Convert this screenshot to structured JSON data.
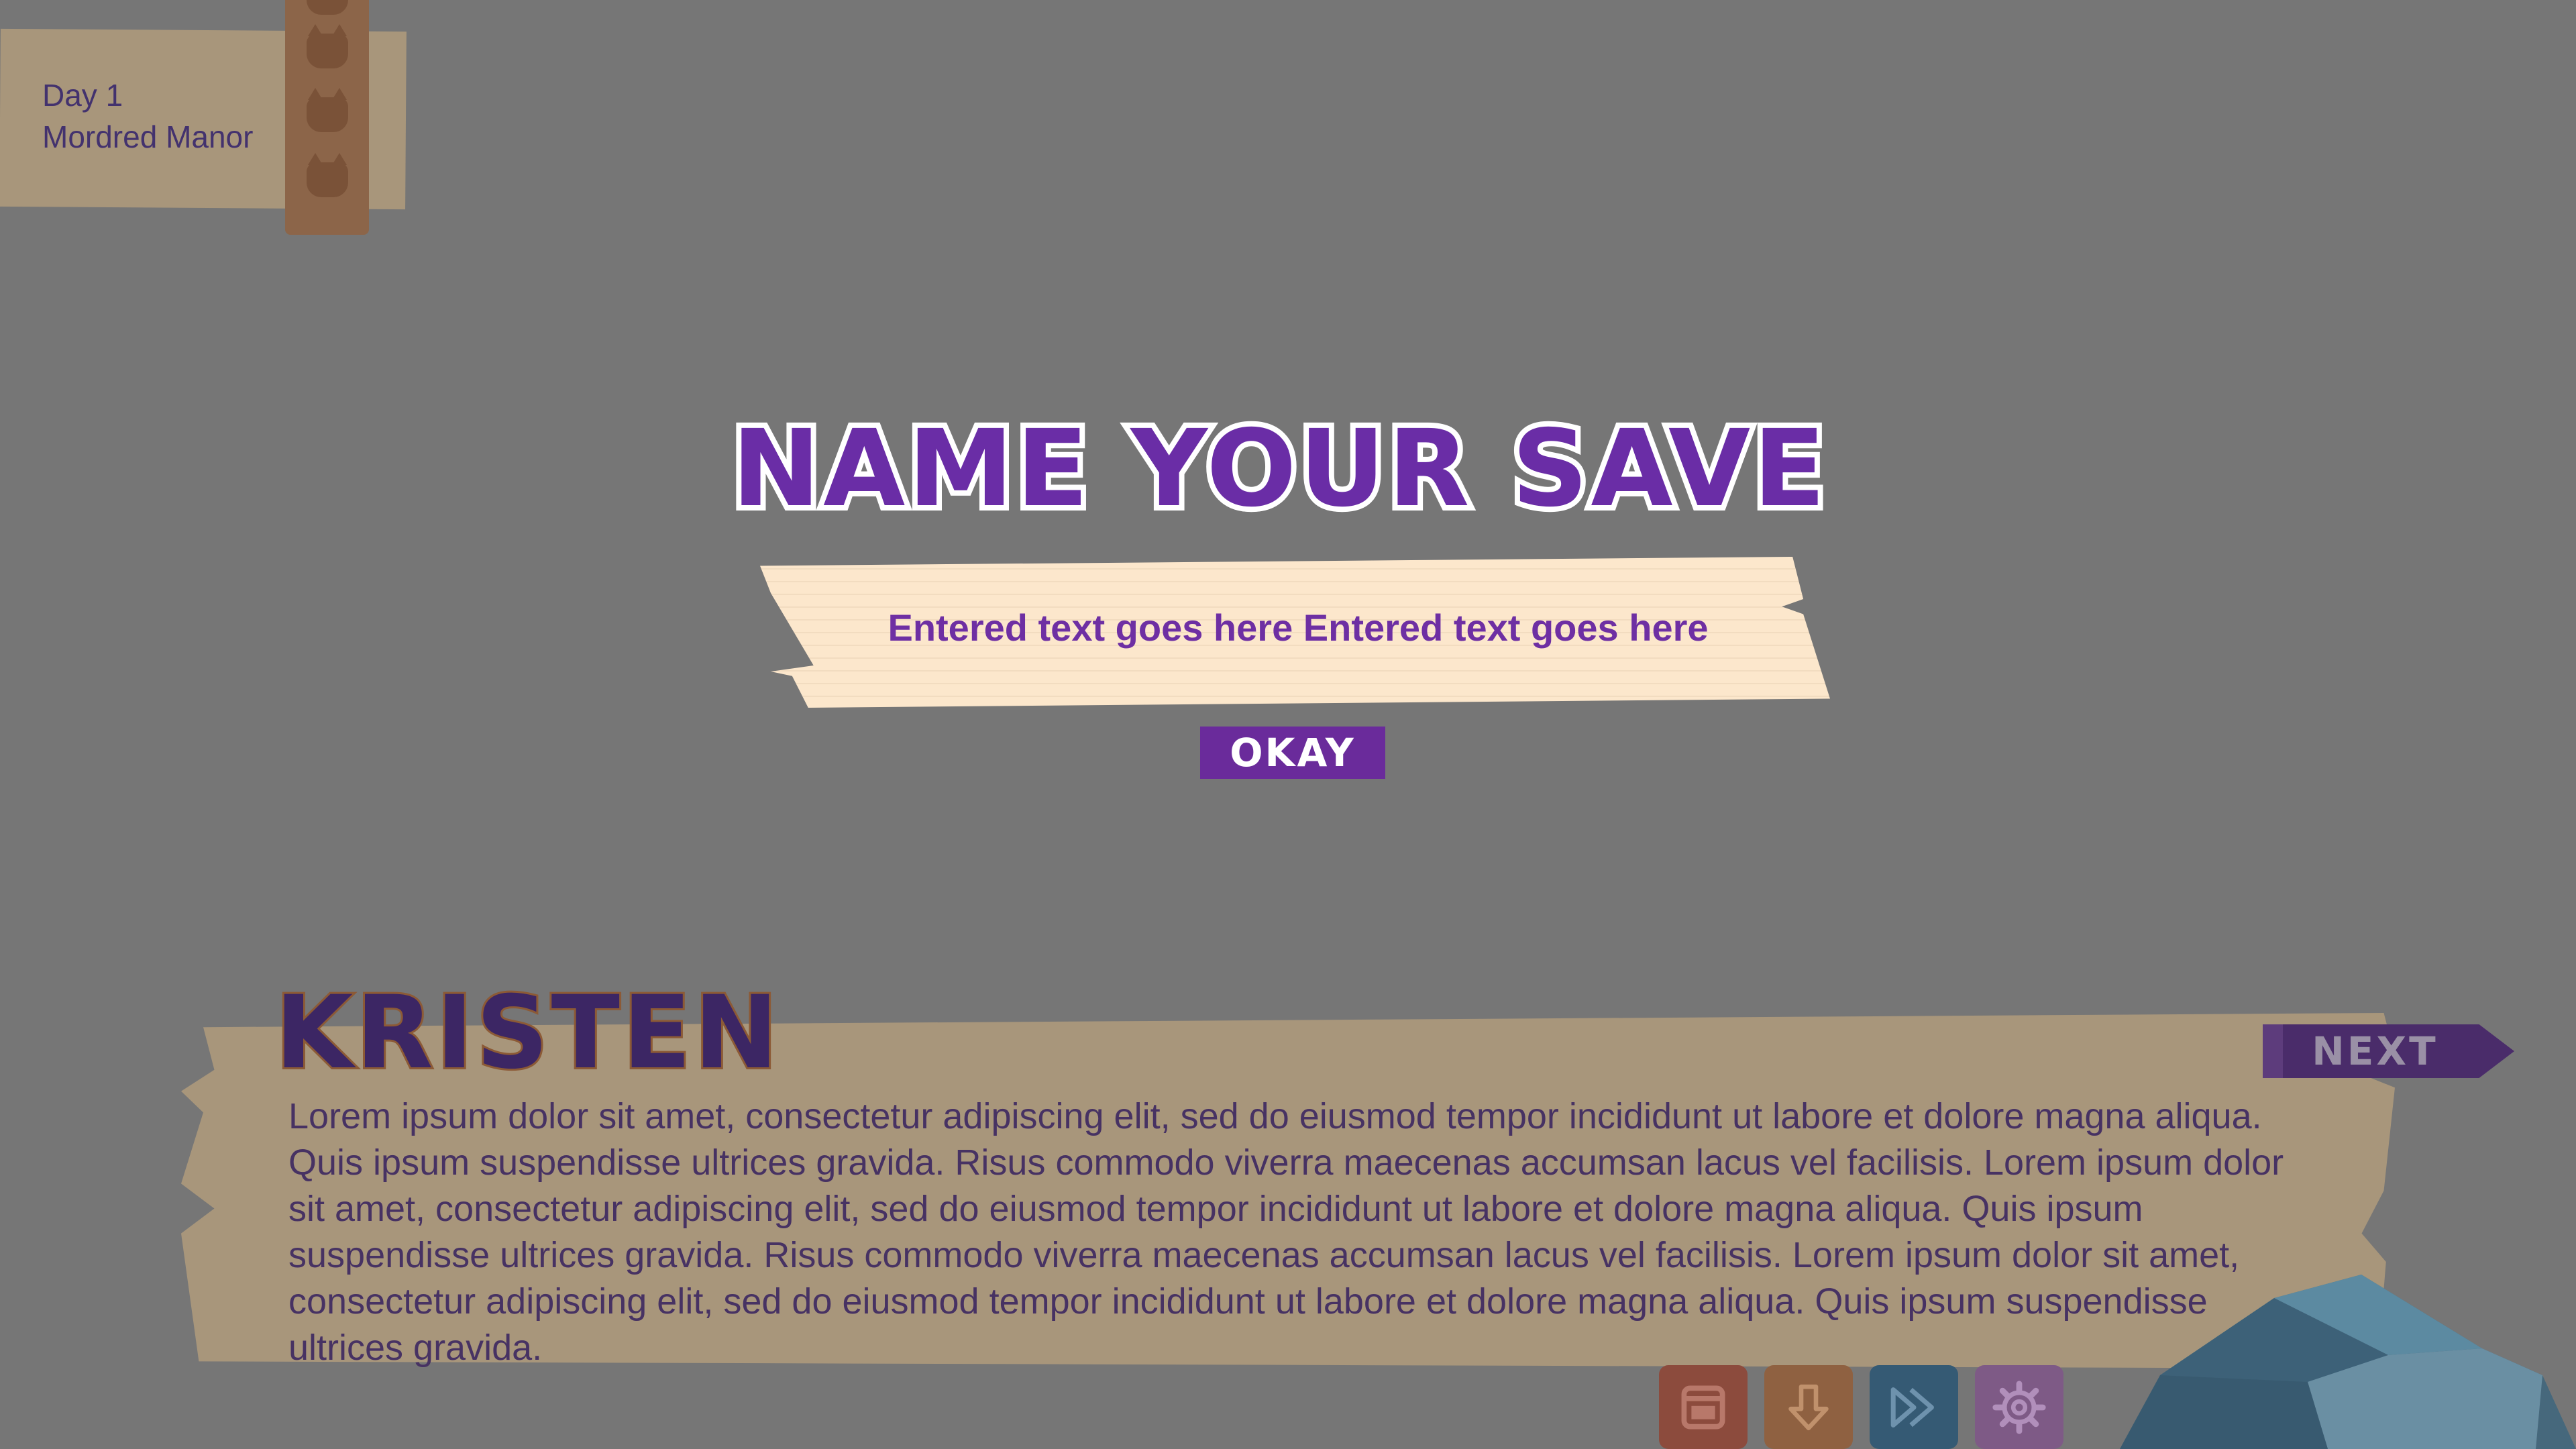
{
  "location": {
    "day": "Day 1",
    "place": "Mordred Manor"
  },
  "dialogue": {
    "speaker": "KRISTEN",
    "text": "Lorem ipsum dolor sit amet, consectetur adipiscing elit, sed do eiusmod tempor incididunt ut labore et dolore magna aliqua. Quis ipsum suspendisse ultrices gravida. Risus commodo viverra maecenas accumsan lacus vel facilisis. Lorem ipsum dolor sit amet, consectetur adipiscing elit, sed do eiusmod tempor incididunt ut labore et dolore magna aliqua. Quis ipsum suspendisse ultrices gravida. Risus commodo viverra maecenas accumsan lacus vel facilisis. Lorem ipsum dolor sit amet, consectetur adipiscing elit, sed do eiusmod tempor incididunt ut labore et dolore magna aliqua. Quis ipsum suspendisse ultrices gravida.",
    "next_label": "NEXT"
  },
  "quick_menu": {
    "icons": [
      "window-icon",
      "save-arrow-icon",
      "fast-forward-icon",
      "gear-icon"
    ]
  },
  "modal": {
    "title": "NAME YOUR SAVE",
    "input_value": "Entered text goes here Entered text goes here",
    "okay_label": "OKAY"
  },
  "colors": {
    "overlay_gray": "#767676",
    "title_purple": "#6a2da6",
    "input_paper": "#fce7cc",
    "okay_purple": "#6a2b9b",
    "next_purple": "#4a2c6a"
  }
}
